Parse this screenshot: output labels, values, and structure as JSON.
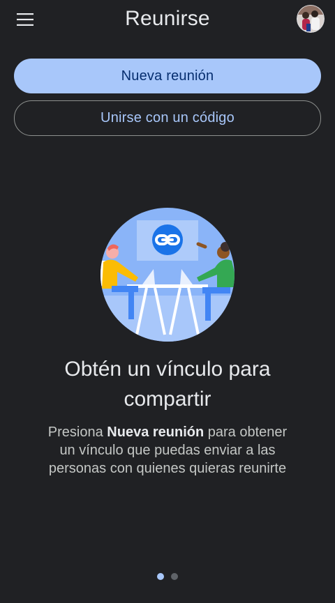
{
  "header": {
    "title": "Reunirse",
    "menu_icon": "hamburger-menu-icon",
    "avatar_icon": "user-avatar"
  },
  "actions": {
    "new_meeting_label": "Nueva reunión",
    "join_code_label": "Unirse con un código"
  },
  "onboarding": {
    "illustration": "share-link-illustration",
    "headline": "Obtén un vínculo para compartir",
    "body_prefix": "Presiona ",
    "body_bold": "Nueva reunión",
    "body_suffix": " para obtener un vínculo que puedas enviar a las personas con quienes quieras reunirte",
    "pages": 2,
    "current_page": 1
  },
  "colors": {
    "background": "#202124",
    "primary_button": "#a8c7fa",
    "primary_button_text": "#062e6f",
    "outline_text": "#a8c7fa"
  }
}
